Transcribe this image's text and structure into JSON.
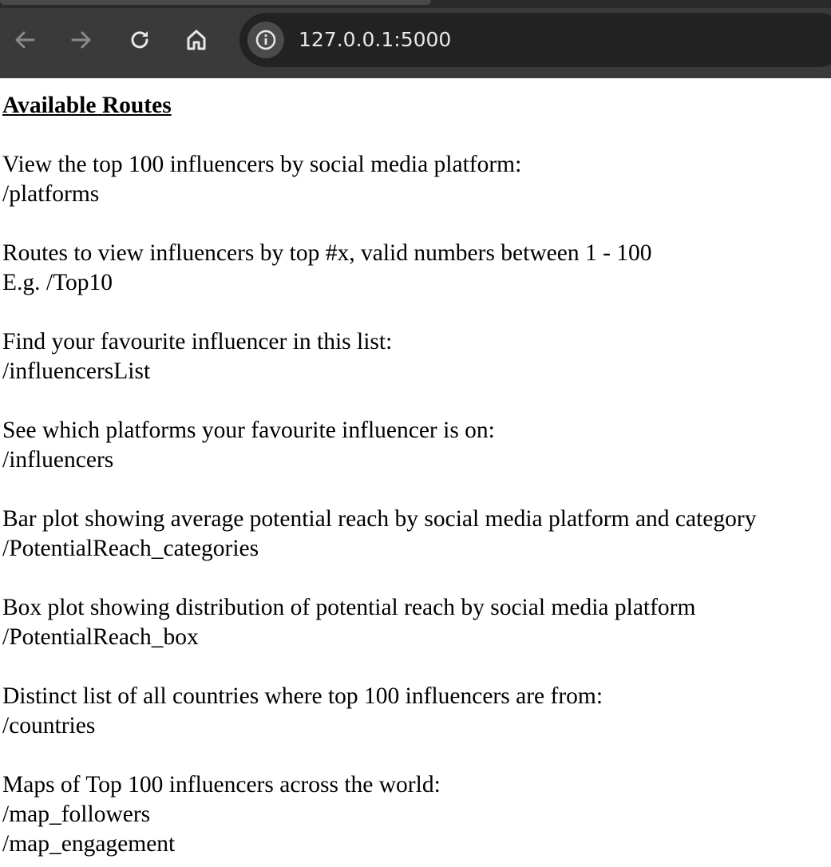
{
  "browser": {
    "url": "127.0.0.1:5000",
    "nav_icons": [
      "back-arrow-icon",
      "forward-arrow-icon",
      "reload-icon",
      "home-icon",
      "info-icon"
    ]
  },
  "page": {
    "heading": "Available Routes",
    "sections": [
      {
        "description": "View the top 100 influencers by social media platform:",
        "routes": [
          "/platforms"
        ]
      },
      {
        "description": "Routes to view influencers by top #x, valid numbers between 1 - 100",
        "routes": [
          "E.g. /Top10"
        ]
      },
      {
        "description": "Find your favourite influencer in this list:",
        "routes": [
          "/influencersList"
        ]
      },
      {
        "description": "See which platforms your favourite influencer is on:",
        "routes": [
          "/influencers"
        ]
      },
      {
        "description": "Bar plot showing average potential reach by social media platform and category",
        "routes": [
          "/PotentialReach_categories"
        ]
      },
      {
        "description": "Box plot showing distribution of potential reach by social media platform",
        "routes": [
          "/PotentialReach_box"
        ]
      },
      {
        "description": "Distinct list of all countries where top 100 influencers are from:",
        "routes": [
          "/countries"
        ]
      },
      {
        "description": "Maps of Top 100 influencers across the world:",
        "routes": [
          "/map_followers",
          "/map_engagement"
        ]
      }
    ]
  }
}
